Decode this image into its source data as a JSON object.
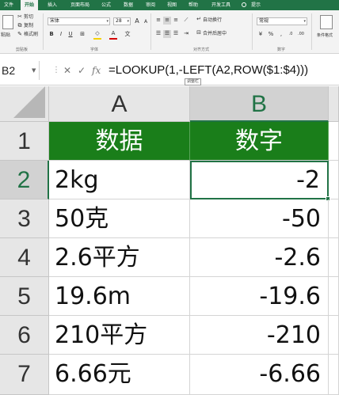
{
  "ribbon": {
    "tabs": [
      {
        "label": "文件",
        "active": false
      },
      {
        "label": "开始",
        "active": true
      },
      {
        "label": "插入",
        "active": false
      },
      {
        "label": "页面布局",
        "active": false
      },
      {
        "label": "公式",
        "active": false
      },
      {
        "label": "数据",
        "active": false
      },
      {
        "label": "审阅",
        "active": false
      },
      {
        "label": "视图",
        "active": false
      },
      {
        "label": "帮助",
        "active": false
      },
      {
        "label": "开发工具",
        "active": false
      },
      {
        "label": "提示",
        "active": false
      }
    ],
    "clipboard": {
      "cut": "剪切",
      "copy": "复制",
      "format_painter": "格式刷",
      "paste": "粘贴",
      "group": "剪贴板"
    },
    "font": {
      "name": "宋体",
      "size": "28",
      "bold": "B",
      "italic": "I",
      "underline": "U",
      "grow": "A",
      "shrink": "A",
      "group": "字体"
    },
    "alignment": {
      "wrap": "自动换行",
      "merge": "合并后居中",
      "group": "对齐方式"
    },
    "number": {
      "format": "常规",
      "group": "数字"
    },
    "cells": {
      "format": "条件格式"
    },
    "colors": {
      "accent": "#217346",
      "header_fill": "#1a7e1a",
      "fill_yellow": "#f5d100",
      "font_red": "#d40000"
    }
  },
  "formula_bar": {
    "name_box": "B2",
    "formula": "=LOOKUP(1,-LEFT(A2,ROW($1:$4)))",
    "tooltip": "调整栏",
    "icons": [
      "cancel-icon",
      "enter-icon",
      "function-icon"
    ]
  },
  "grid": {
    "corner": "select-all",
    "columns": [
      "A",
      "B"
    ],
    "selected_column": "B",
    "rows": [
      {
        "num": "1",
        "a": "数据",
        "b": "数字",
        "header": true
      },
      {
        "num": "2",
        "a": "2kg",
        "b": "-2",
        "active": true
      },
      {
        "num": "3",
        "a": "50克",
        "b": "-50"
      },
      {
        "num": "4",
        "a": "2.6平方",
        "b": "-2.6"
      },
      {
        "num": "5",
        "a": "19.6m",
        "b": "-19.6"
      },
      {
        "num": "6",
        "a": "210平方",
        "b": "-210"
      },
      {
        "num": "7",
        "a": "6.66元",
        "b": "-6.66"
      }
    ],
    "selected_row": "2",
    "active_cell": "B2"
  }
}
